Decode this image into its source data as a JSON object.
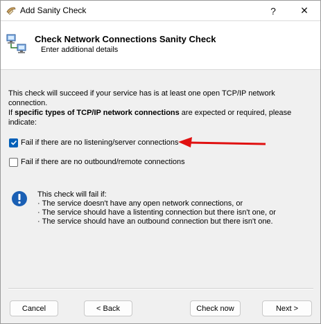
{
  "window": {
    "title": "Add Sanity Check",
    "help_label": "?",
    "close_label": "✕"
  },
  "header": {
    "title": "Check Network Connections Sanity Check",
    "subtitle": "Enter additional details"
  },
  "description": {
    "line1": "This check will succeed if your service has is at least one open TCP/IP network connection.",
    "line2_prefix": "If ",
    "line2_bold": "specific types of TCP/IP network connections",
    "line2_suffix": " are expected or required, please",
    "line3": "indicate:"
  },
  "options": [
    {
      "label": "Fail if there are no listening/server connections",
      "checked": true
    },
    {
      "label": "Fail if there are no outbound/remote connections",
      "checked": false
    }
  ],
  "info": {
    "heading": "This check will fail if:",
    "items": [
      "The service doesn't have any open network connections, or",
      "The service should have a listenting connection but there isn't one, or",
      "The service should have an outbound connection but there isn't one."
    ]
  },
  "buttons": {
    "cancel": "Cancel",
    "back": "< Back",
    "check_now": "Check now",
    "next": "Next >"
  },
  "colors": {
    "checkbox_accent": "#005fb8",
    "annotation_arrow": "#e01010",
    "info_icon": "#1a5fb4"
  }
}
